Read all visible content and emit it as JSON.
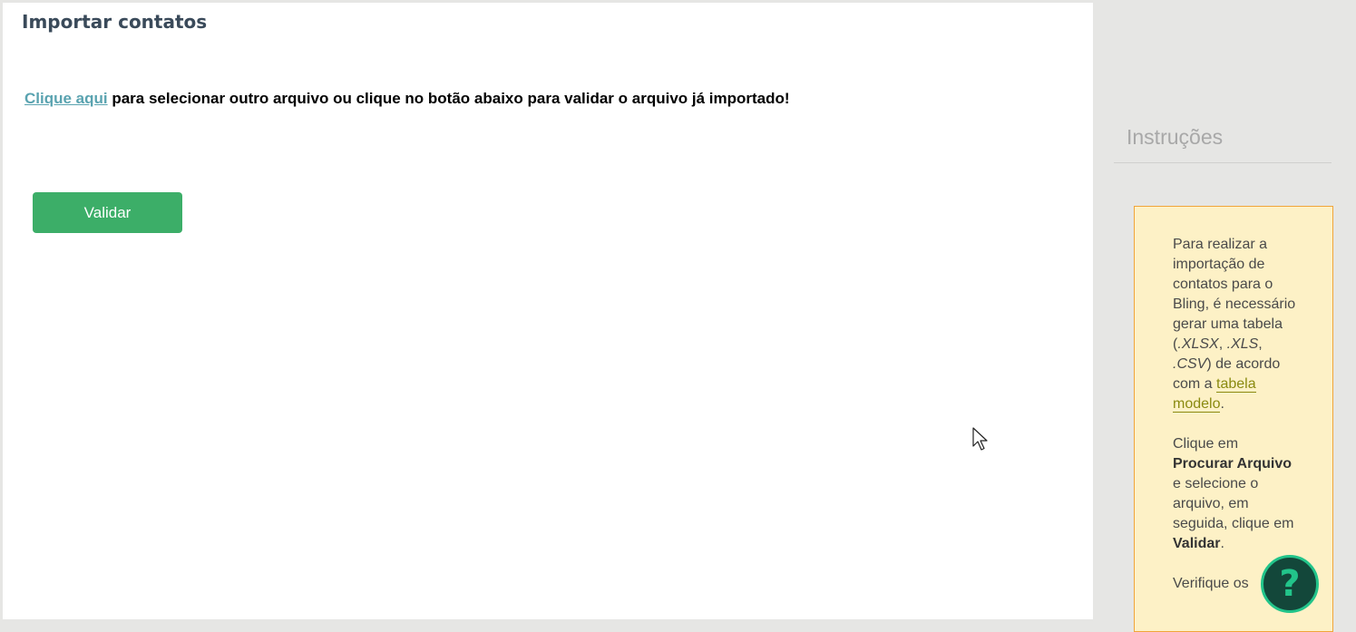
{
  "page": {
    "title": "Importar contatos"
  },
  "instruction": {
    "link_label": "Clique aqui",
    "text": " para selecionar outro arquivo ou clique no botão abaixo para validar o arquivo já importado!"
  },
  "actions": {
    "validate_label": "Validar"
  },
  "sidebar": {
    "title": "Instruções",
    "note": {
      "p1_a": "Para realizar a importação de contatos para o Bling, é necessário gerar uma tabela (",
      "p1_xlsx": ".XLSX",
      "p1_sep1": ", ",
      "p1_xls": ".XLS",
      "p1_sep2": ", ",
      "p1_csv": ".CSV",
      "p1_b": ") de acordo com a ",
      "p1_link": "tabela modelo",
      "p1_end": ".",
      "p2_a": "Clique em ",
      "p2_bold1": "Procurar Arquivo",
      "p2_b": " e selecione o arquivo, em seguida, clique em ",
      "p2_bold2": "Validar",
      "p2_end": ".",
      "p3_a": "Verifique os"
    }
  },
  "help": {
    "label": "?"
  },
  "colors": {
    "accent_green": "#3cae68",
    "link_blue": "#5aa3b0",
    "note_bg": "#fdf1c6",
    "note_border": "#f0a53a",
    "help_bg": "#13473a",
    "help_fg": "#22c48a"
  }
}
